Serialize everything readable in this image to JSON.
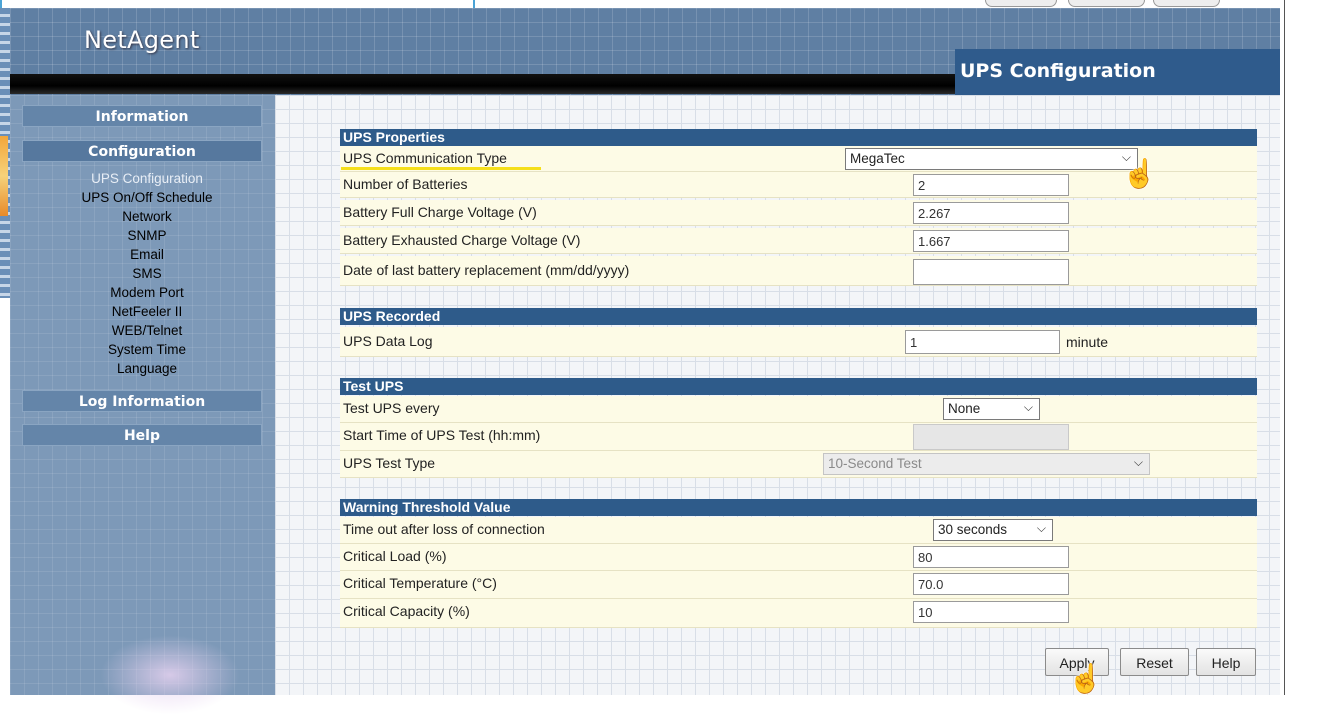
{
  "header": {
    "logo": "NetAgent",
    "page_title": "UPS Configuration"
  },
  "sidebar": {
    "information": "Information",
    "configuration": "Configuration",
    "config_items": [
      {
        "label": "UPS Configuration",
        "current": true
      },
      {
        "label": "UPS On/Off Schedule"
      },
      {
        "label": "Network"
      },
      {
        "label": "SNMP"
      },
      {
        "label": "Email"
      },
      {
        "label": "SMS"
      },
      {
        "label": "Modem Port"
      },
      {
        "label": "NetFeeler II"
      },
      {
        "label": "WEB/Telnet"
      },
      {
        "label": "System Time"
      },
      {
        "label": "Language"
      }
    ],
    "log_information": "Log Information",
    "help": "Help"
  },
  "ups_properties": {
    "title": "UPS Properties",
    "comm_type_label": "UPS Communication Type",
    "comm_type_value": "MegaTec",
    "num_batteries_label": "Number of Batteries",
    "num_batteries_value": "2",
    "full_charge_label": "Battery Full Charge Voltage (V)",
    "full_charge_value": "2.267",
    "exhausted_label": "Battery Exhausted Charge Voltage (V)",
    "exhausted_value": "1.667",
    "last_replacement_label": "Date of last battery replacement (mm/dd/yyyy)",
    "last_replacement_value": ""
  },
  "ups_recorded": {
    "title": "UPS Recorded",
    "data_log_label": "UPS Data Log",
    "data_log_value": "1",
    "data_log_unit": "minute"
  },
  "test_ups": {
    "title": "Test UPS",
    "every_label": "Test UPS every",
    "every_value": "None",
    "start_time_label": "Start Time of UPS Test (hh:mm)",
    "start_time_value": "",
    "type_label": "UPS Test Type",
    "type_value": "10-Second Test"
  },
  "warning": {
    "title": "Warning Threshold Value",
    "timeout_label": "Time out after loss of connection",
    "timeout_value": "30 seconds",
    "critical_load_label": "Critical Load (%)",
    "critical_load_value": "80",
    "critical_temp_label": "Critical Temperature (°C)",
    "critical_temp_value": "70.0",
    "critical_capacity_label": "Critical Capacity (%)",
    "critical_capacity_value": "10"
  },
  "buttons": {
    "apply": "Apply",
    "reset": "Reset",
    "help": "Help"
  },
  "icons": {
    "chevron": "chevron-down-icon",
    "cursor": "hand-pointer-icon"
  },
  "colors": {
    "section_header": "#2e5b8a",
    "row_background": "#fdfbe6",
    "highlight_underline": "#f5df1a",
    "title_bar": "#2f5b8c"
  }
}
